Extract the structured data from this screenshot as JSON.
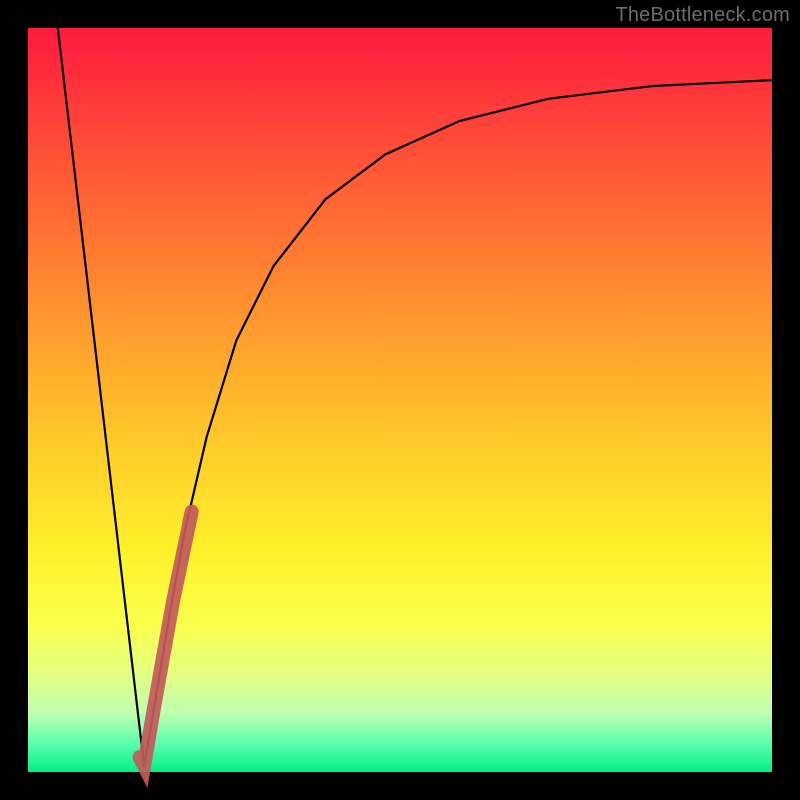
{
  "domain": "Chart",
  "watermark": "TheBottleneck.com",
  "colors": {
    "frame_bg_top": "#ff1a3f",
    "frame_bg_bottom": "#00ef82",
    "line": "#000000",
    "highlight": "#c15a5a",
    "page_bg": "#000000",
    "watermark": "#6d6d6d"
  },
  "chart_data": {
    "type": "line",
    "title": "",
    "xlabel": "",
    "ylabel": "",
    "xlim": [
      0,
      100
    ],
    "ylim": [
      0,
      100
    ],
    "annotations": [],
    "series": [
      {
        "name": "left-falling-segment",
        "x": [
          4.0,
          15.6
        ],
        "values": [
          100.0,
          0.8
        ]
      },
      {
        "name": "right-rising-curve",
        "x": [
          15.6,
          17.0,
          19.0,
          21.0,
          24.0,
          28.0,
          33.0,
          40.0,
          48.0,
          58.0,
          70.0,
          84.0,
          100.0
        ],
        "values": [
          0.8,
          9.0,
          21.0,
          32.0,
          45.0,
          58.0,
          68.0,
          77.0,
          83.0,
          87.5,
          90.5,
          92.2,
          93.0
        ]
      },
      {
        "name": "highlight-segment",
        "x": [
          15.0,
          15.6,
          17.0,
          19.5,
          22.0
        ],
        "values": [
          2.0,
          0.8,
          9.0,
          23.0,
          35.0
        ]
      }
    ]
  }
}
